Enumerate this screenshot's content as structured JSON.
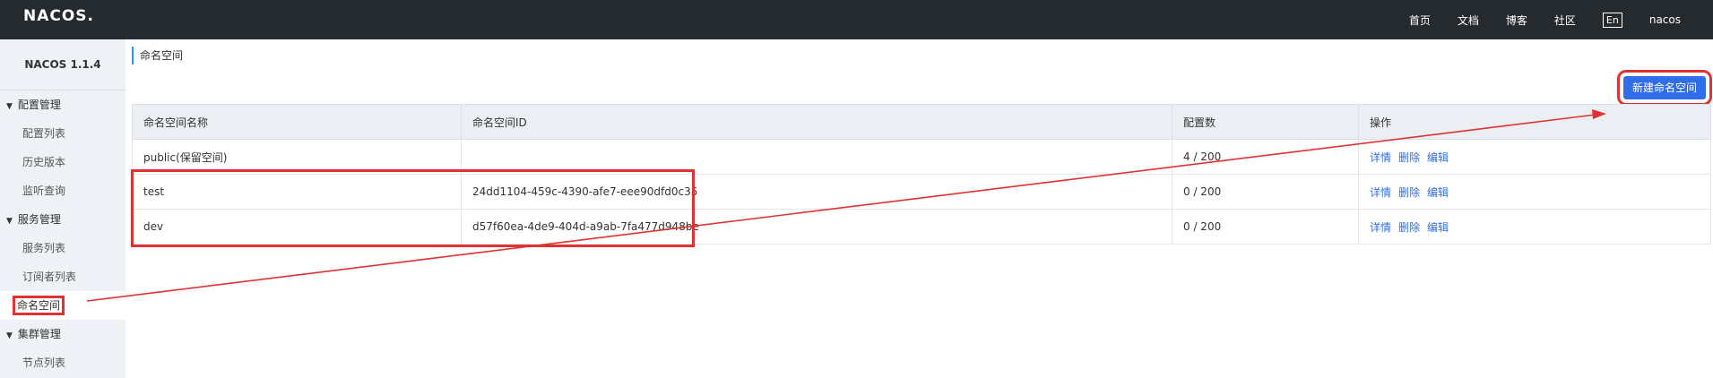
{
  "header": {
    "logo": "NACOS.",
    "nav": [
      "首页",
      "文档",
      "博客",
      "社区"
    ],
    "lang": "En",
    "user": "nacos"
  },
  "sidebar": {
    "version": "NACOS 1.1.4",
    "groups": [
      {
        "label": "配置管理",
        "items": [
          "配置列表",
          "历史版本",
          "监听查询"
        ]
      },
      {
        "label": "服务管理",
        "items": [
          "服务列表",
          "订阅者列表",
          "命名空间"
        ]
      },
      {
        "label": "集群管理",
        "items": [
          "节点列表"
        ]
      }
    ],
    "active_item": "命名空间"
  },
  "main": {
    "title": "命名空间",
    "create_button": "新建命名空间",
    "table": {
      "columns": [
        "命名空间名称",
        "命名空间ID",
        "配置数",
        "操作"
      ],
      "rows": [
        {
          "name": "public(保留空间)",
          "id": "",
          "count": "4 / 200"
        },
        {
          "name": "test",
          "id": "24dd1104-459c-4390-afe7-eee90dfd0c35",
          "count": "0 / 200"
        },
        {
          "name": "dev",
          "id": "d57f60ea-4de9-404d-a9ab-7fa477d948be",
          "count": "0 / 200"
        }
      ],
      "actions": [
        "详情",
        "删除",
        "编辑"
      ]
    }
  },
  "colors": {
    "topbar": "#252a2f",
    "accent": "#2f6ee8",
    "annotation": "#e03232"
  }
}
